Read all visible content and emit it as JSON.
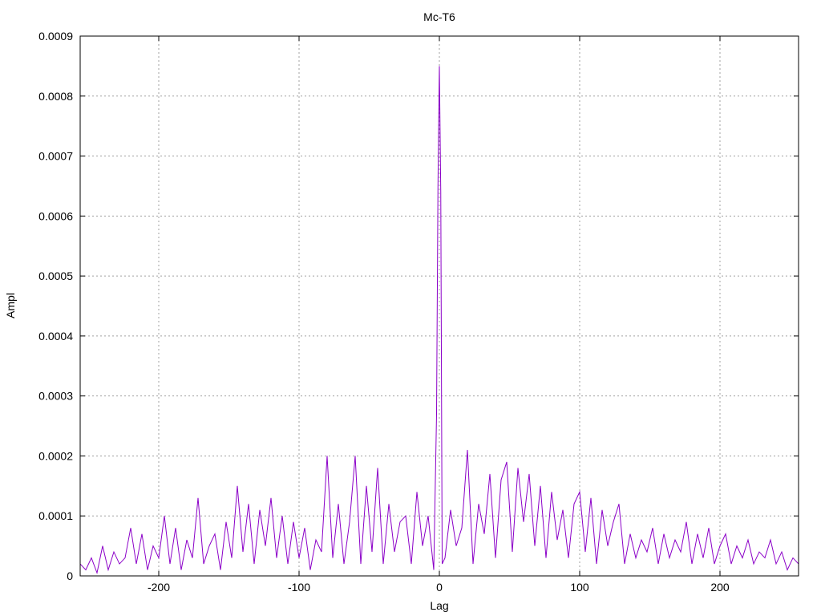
{
  "chart_data": {
    "type": "line",
    "title": "Mc-T6",
    "xlabel": "Lag",
    "ylabel": "Ampl",
    "xlim": [
      -256,
      256
    ],
    "ylim": [
      0,
      0.0009
    ],
    "grid": true,
    "line_color": "#8b00c8",
    "x_ticks": [
      -200,
      -100,
      0,
      100,
      200
    ],
    "x_tick_labels": [
      "-200",
      "-100",
      "0",
      "100",
      "200"
    ],
    "y_ticks": [
      0,
      0.0001,
      0.0002,
      0.0003,
      0.0004,
      0.0005,
      0.0006,
      0.0007,
      0.0008,
      0.0009
    ],
    "y_tick_labels": [
      "0",
      "0.0001",
      "0.0002",
      "0.0003",
      "0.0004",
      "0.0005",
      "0.0006",
      "0.0007",
      "0.0008",
      "0.0009"
    ],
    "series": [
      {
        "x": [
          -256,
          -252,
          -248,
          -244,
          -240,
          -236,
          -232,
          -228,
          -224,
          -220,
          -216,
          -212,
          -208,
          -204,
          -200,
          -196,
          -192,
          -188,
          -184,
          -180,
          -176,
          -172,
          -168,
          -164,
          -160,
          -156,
          -152,
          -148,
          -144,
          -140,
          -136,
          -132,
          -128,
          -124,
          -120,
          -116,
          -112,
          -108,
          -104,
          -100,
          -96,
          -92,
          -88,
          -84,
          -80,
          -76,
          -72,
          -68,
          -64,
          -60,
          -56,
          -52,
          -48,
          -44,
          -40,
          -36,
          -32,
          -28,
          -24,
          -20,
          -16,
          -12,
          -8,
          -4,
          -2,
          -1,
          0,
          1,
          2,
          4,
          8,
          12,
          16,
          20,
          24,
          28,
          32,
          36,
          40,
          44,
          48,
          52,
          56,
          60,
          64,
          68,
          72,
          76,
          80,
          84,
          88,
          92,
          96,
          100,
          104,
          108,
          112,
          116,
          120,
          124,
          128,
          132,
          136,
          140,
          144,
          148,
          152,
          156,
          160,
          164,
          168,
          172,
          176,
          180,
          184,
          188,
          192,
          196,
          200,
          204,
          208,
          212,
          216,
          220,
          224,
          228,
          232,
          236,
          240,
          244,
          248,
          252,
          256
        ],
        "y": [
          2e-05,
          1e-05,
          3e-05,
          5e-06,
          5e-05,
          1e-05,
          4e-05,
          2e-05,
          3e-05,
          8e-05,
          2e-05,
          7e-05,
          1e-05,
          5e-05,
          3e-05,
          0.0001,
          2e-05,
          8e-05,
          1e-05,
          6e-05,
          3e-05,
          0.00013,
          2e-05,
          5e-05,
          7e-05,
          1e-05,
          9e-05,
          3e-05,
          0.00015,
          4e-05,
          0.00012,
          2e-05,
          0.00011,
          5e-05,
          0.00013,
          3e-05,
          0.0001,
          2e-05,
          9e-05,
          3e-05,
          8e-05,
          1e-05,
          6e-05,
          4e-05,
          0.0002,
          3e-05,
          0.00012,
          2e-05,
          9e-05,
          0.0002,
          2e-05,
          0.00015,
          4e-05,
          0.00018,
          2e-05,
          0.00012,
          4e-05,
          9e-05,
          0.0001,
          2e-05,
          0.00014,
          5e-05,
          0.0001,
          1e-05,
          0.00027,
          0.00065,
          0.00085,
          0.00064,
          2e-05,
          3e-05,
          0.00011,
          5e-05,
          8e-05,
          0.00021,
          2e-05,
          0.00012,
          7e-05,
          0.00017,
          3e-05,
          0.00016,
          0.00019,
          4e-05,
          0.00018,
          9e-05,
          0.00017,
          5e-05,
          0.00015,
          3e-05,
          0.00014,
          6e-05,
          0.00011,
          3e-05,
          0.00012,
          0.00014,
          4e-05,
          0.00013,
          2e-05,
          0.00011,
          5e-05,
          9e-05,
          0.00012,
          2e-05,
          7e-05,
          3e-05,
          6e-05,
          4e-05,
          8e-05,
          2e-05,
          7e-05,
          3e-05,
          6e-05,
          4e-05,
          9e-05,
          2e-05,
          7e-05,
          3e-05,
          8e-05,
          2e-05,
          5e-05,
          7e-05,
          2e-05,
          5e-05,
          3e-05,
          6e-05,
          2e-05,
          4e-05,
          3e-05,
          6e-05,
          2e-05,
          4e-05,
          1e-05,
          3e-05,
          2e-05
        ]
      }
    ]
  }
}
